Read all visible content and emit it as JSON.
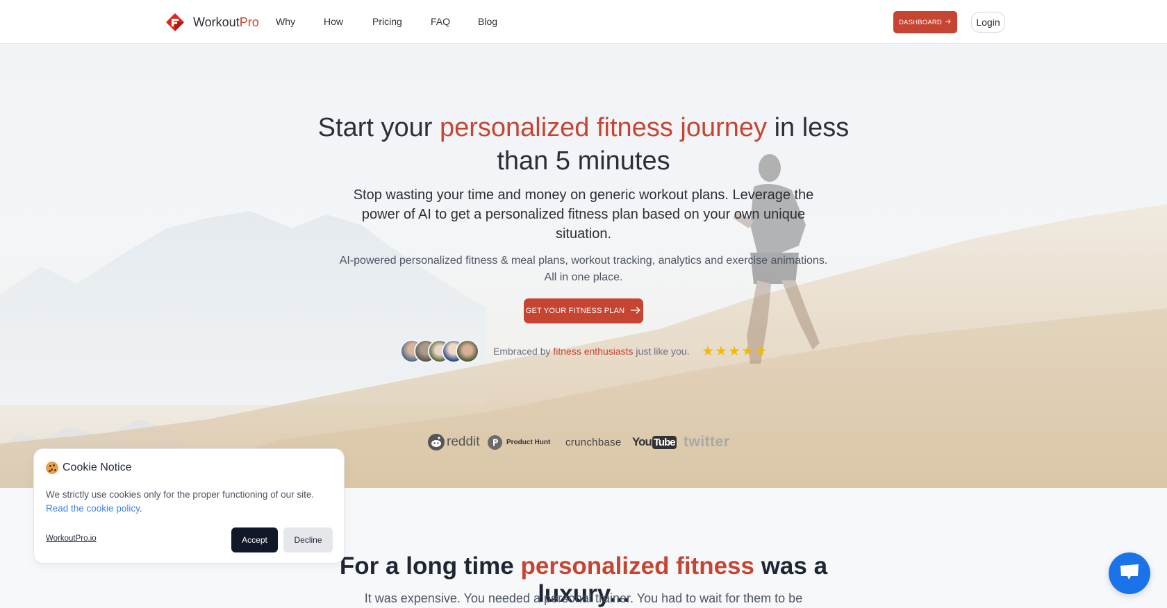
{
  "header": {
    "logo_icon": "workoutpro-logo-icon",
    "logo_primary": "Workout",
    "logo_accent": "Pro",
    "nav": [
      {
        "label": "Why"
      },
      {
        "label": "How"
      },
      {
        "label": "Pricing"
      },
      {
        "label": "FAQ"
      },
      {
        "label": "Blog"
      }
    ],
    "dashboard_label": "DASHBOARD",
    "dashboard_icon": "arrow-right-icon",
    "login_label": "Login"
  },
  "hero": {
    "headline_pre": "Start your ",
    "headline_accent": "personalized fitness journey",
    "headline_post": " in less than 5 minutes",
    "subhead": "Stop wasting your time and money on generic workout plans. Leverage the power of AI to get a personalized fitness plan based on your own unique situation.",
    "tagline_line1": "AI-powered personalized fitness & meal plans, workout tracking, analytics and exercise animations.",
    "tagline_line2": "All in one place.",
    "cta_label": "GET YOUR FITNESS PLAN",
    "cta_icon": "arrow-right-icon",
    "social_pre": "Embraced by ",
    "social_accent": "fitness enthusiasts",
    "social_post": " just like you.",
    "rating_stars": 5,
    "rating_max": 5,
    "press": [
      {
        "name": "reddit",
        "icon": "reddit-icon"
      },
      {
        "name": "Product Hunt",
        "icon": "product-hunt-icon"
      },
      {
        "name": "crunchbase",
        "icon": "crunchbase-logo"
      },
      {
        "name": "YouTube",
        "icon": "youtube-logo"
      },
      {
        "name": "twitter",
        "icon": "twitter-logo"
      }
    ]
  },
  "section2": {
    "title_pre": "For a long time ",
    "title_accent": "personalized fitness",
    "title_post": " was a luxury...",
    "subtitle": "It was expensive. You needed a personal trainer. You had to wait for them to be"
  },
  "cookie": {
    "icon": "cookie-icon",
    "title": "Cookie Notice",
    "text": "We strictly use cookies only for the proper functioning of our site.",
    "link_label": "Read the cookie policy",
    "link_suffix": ".",
    "site_label": "WorkoutPro.io",
    "accept_label": "Accept",
    "decline_label": "Decline"
  },
  "chat": {
    "icon": "chat-bubble-icon"
  },
  "colors": {
    "accent": "#c64432",
    "star": "#f5b800",
    "link": "#3b82f6",
    "chat": "#1a73e8",
    "dark_button": "#111827"
  }
}
